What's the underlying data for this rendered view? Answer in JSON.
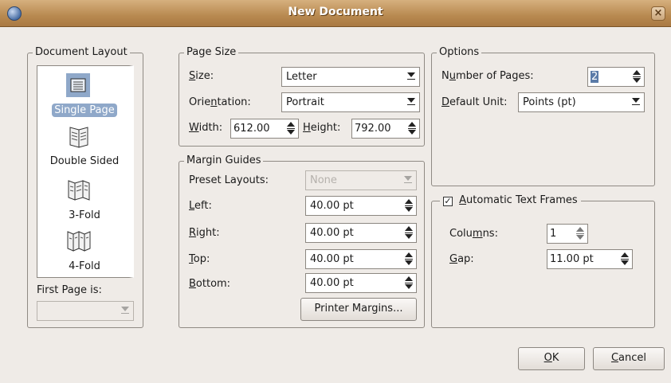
{
  "window": {
    "title": "New Document"
  },
  "document_layout": {
    "legend": "Document Layout",
    "items": [
      {
        "label": "Single Page",
        "icon": "single-page-icon",
        "selected": true
      },
      {
        "label": "Double Sided",
        "icon": "double-sided-icon",
        "selected": false
      },
      {
        "label": "3-Fold",
        "icon": "three-fold-icon",
        "selected": false
      },
      {
        "label": "4-Fold",
        "icon": "four-fold-icon",
        "selected": false
      }
    ],
    "first_page_label": "First Page is:",
    "first_page_value": ""
  },
  "page_size": {
    "legend": "Page Size",
    "size_label": "Size:",
    "size_value": "Letter",
    "orientation_label": "Orientation:",
    "orientation_value": "Portrait",
    "width_label": "Width:",
    "width_value": "612.00",
    "height_label": "Height:",
    "height_value": "792.00"
  },
  "margin_guides": {
    "legend": "Margin Guides",
    "preset_label": "Preset Layouts:",
    "preset_value": "None",
    "left_label": "Left:",
    "left_value": "40.00 pt",
    "right_label": "Right:",
    "right_value": "40.00 pt",
    "top_label": "Top:",
    "top_value": "40.00 pt",
    "bottom_label": "Bottom:",
    "bottom_value": "40.00 pt",
    "printer_margins_label": "Printer Margins..."
  },
  "options": {
    "legend": "Options",
    "pages_label": "Number of Pages:",
    "pages_value": "2",
    "unit_label": "Default Unit:",
    "unit_value": "Points (pt)"
  },
  "text_frames": {
    "legend": "Automatic Text Frames",
    "checked": true,
    "columns_label": "Columns:",
    "columns_value": "1",
    "gap_label": "Gap:",
    "gap_value": "11.00 pt"
  },
  "buttons": {
    "ok": "OK",
    "cancel": "Cancel"
  }
}
